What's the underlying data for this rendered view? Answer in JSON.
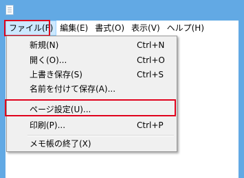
{
  "menubar": {
    "items": [
      {
        "label": "ファイル(F)"
      },
      {
        "label": "編集(E)"
      },
      {
        "label": "書式(O)"
      },
      {
        "label": "表示(V)"
      },
      {
        "label": "ヘルプ(H)"
      }
    ]
  },
  "file_menu": {
    "items": [
      {
        "label": "新規(N)",
        "shortcut": "Ctrl+N"
      },
      {
        "label": "開く(O)...",
        "shortcut": "Ctrl+O"
      },
      {
        "label": "上書き保存(S)",
        "shortcut": "Ctrl+S"
      },
      {
        "label": "名前を付けて保存(A)..."
      },
      {
        "label": "ページ設定(U)..."
      },
      {
        "label": "印刷(P)...",
        "shortcut": "Ctrl+P"
      },
      {
        "label": "メモ帳の終了(X)"
      }
    ]
  },
  "colors": {
    "title_bar": "#62a9e4",
    "highlight_box": "#e0001b",
    "menu_background": "#f0f0f0"
  },
  "icons": {
    "app": "notepad-icon"
  }
}
